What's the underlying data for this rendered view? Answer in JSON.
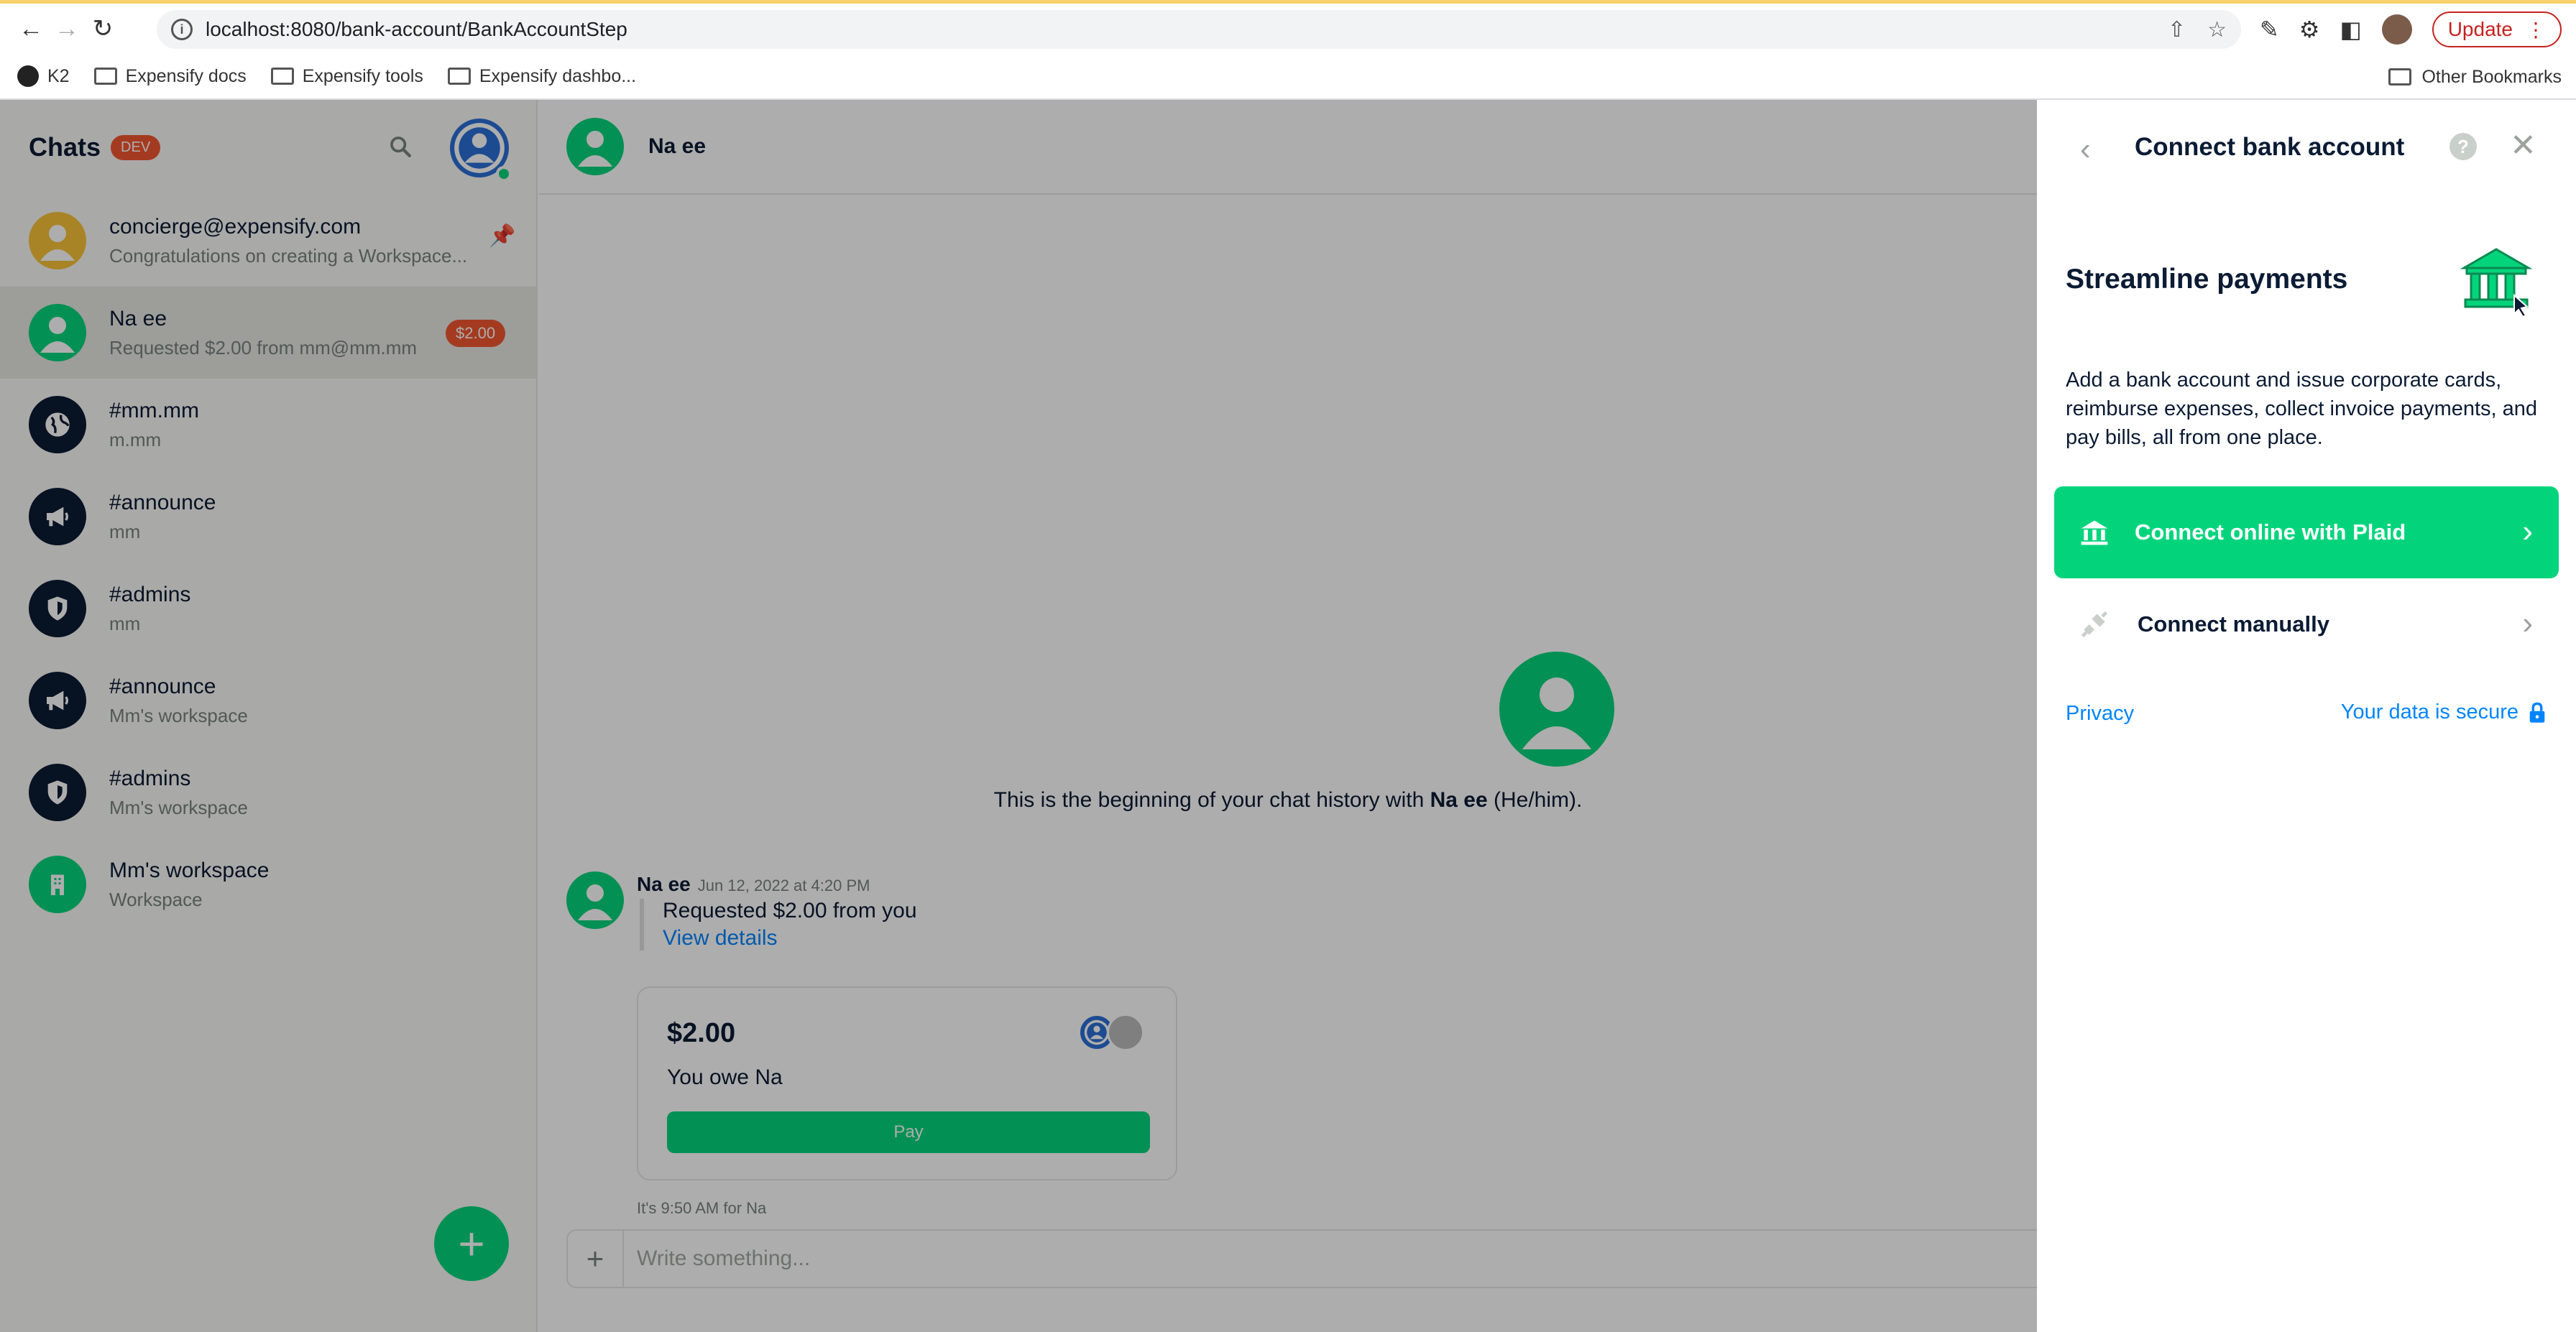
{
  "browser": {
    "url": "localhost:8080/bank-account/BankAccountStep",
    "update_label": "Update",
    "bookmarks": [
      "K2",
      "Expensify docs",
      "Expensify tools",
      "Expensify dashbo..."
    ],
    "other_bookmarks": "Other Bookmarks"
  },
  "sidebar": {
    "title": "Chats",
    "env_badge": "DEV",
    "chats": [
      {
        "name": "concierge@expensify.com",
        "sub": "Congratulations on creating a Workspace..."
      },
      {
        "name": "Na ee",
        "sub": "Requested $2.00 from mm@mm.mm",
        "badge": "$2.00"
      },
      {
        "name": "#mm.mm",
        "sub": "m.mm"
      },
      {
        "name": "#announce",
        "sub": "mm"
      },
      {
        "name": "#admins",
        "sub": "mm"
      },
      {
        "name": "#announce",
        "sub": "Mm's workspace"
      },
      {
        "name": "#admins",
        "sub": "Mm's workspace"
      },
      {
        "name": "Mm's workspace",
        "sub": "Workspace"
      }
    ],
    "fab_label": "+"
  },
  "chat": {
    "header_name": "Na ee",
    "intro_prefix": "This is the beginning of your chat history with ",
    "intro_name": "Na ee",
    "intro_suffix": " (He/him).",
    "message": {
      "author": "Na ee",
      "time": "Jun 12, 2022 at 4:20 PM",
      "text": "Requested $2.00 from you",
      "link": "View details"
    },
    "iou": {
      "amount": "$2.00",
      "owe_text": "You owe Na",
      "pay_label": "Pay"
    },
    "local_time": "It's 9:50 AM for Na",
    "composer_placeholder": "Write something..."
  },
  "panel": {
    "title": "Connect bank account",
    "heading": "Streamline payments",
    "description": "Add a bank account and issue corporate cards, reimburse expenses, collect invoice payments, and pay bills, all from one place.",
    "plaid_label": "Connect online with Plaid",
    "manual_label": "Connect manually",
    "privacy_label": "Privacy",
    "secure_label": "Your data is secure"
  },
  "colors": {
    "accent_green": "#03d47c",
    "link_blue": "#0185ff",
    "badge_red": "#f25730"
  }
}
